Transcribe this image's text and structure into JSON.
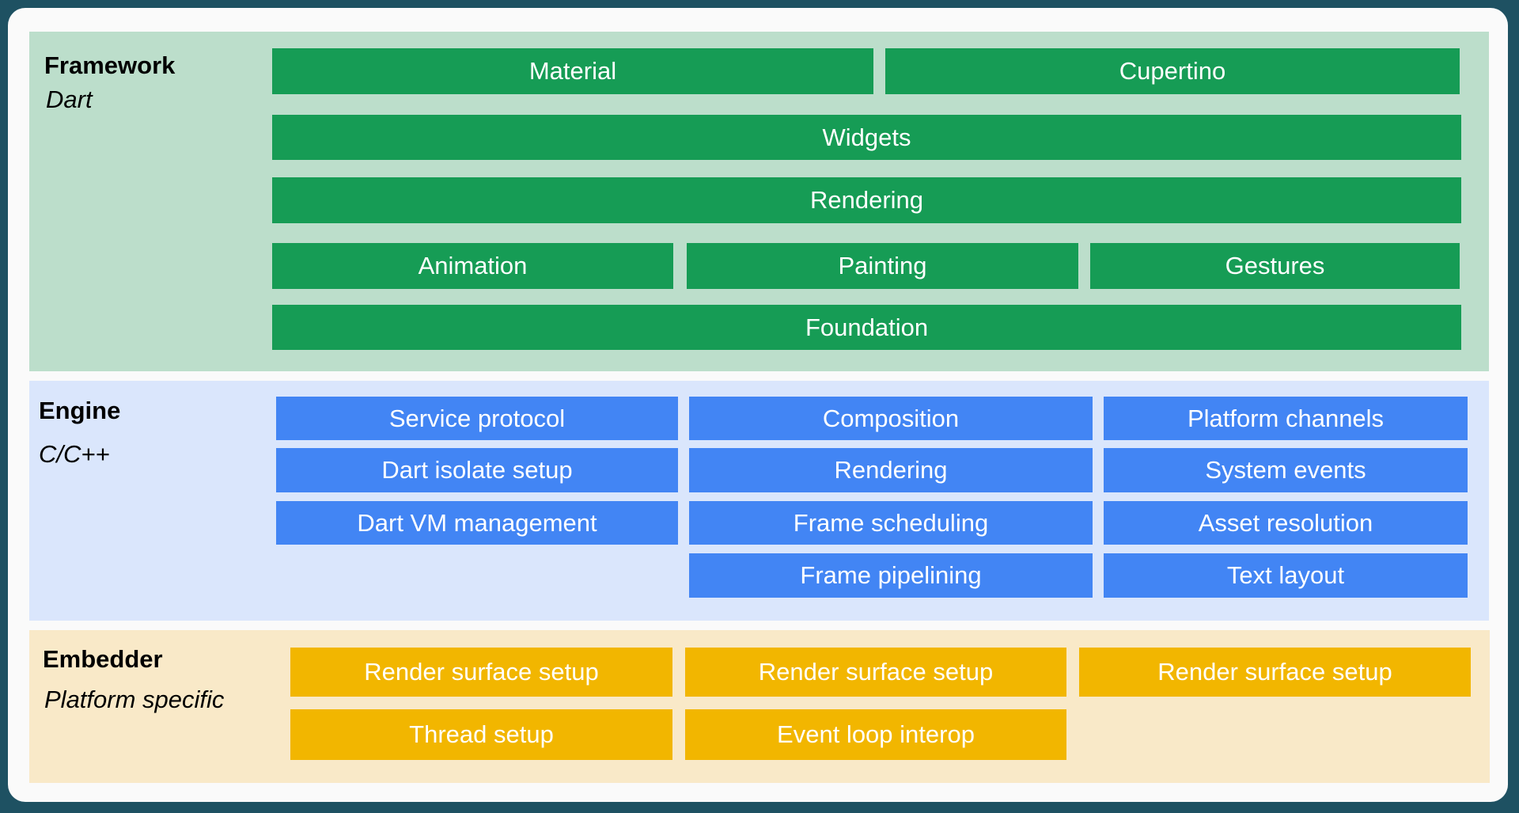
{
  "colors": {
    "border": "#1e5162",
    "framework_bg": "#bcdecb",
    "framework_box": "#169c55",
    "engine_bg": "#dae6fc",
    "engine_box": "#4285f4",
    "embedder_bg": "#f9e9c8",
    "embedder_box": "#f2b600"
  },
  "framework": {
    "title": "Framework",
    "subtitle": "Dart",
    "boxes": [
      "Material",
      "Cupertino",
      "Widgets",
      "Rendering",
      "Animation",
      "Painting",
      "Gestures",
      "Foundation"
    ]
  },
  "engine": {
    "title": "Engine",
    "subtitle": "C/C++",
    "boxes": [
      "Service protocol",
      "Composition",
      "Platform channels",
      "Dart isolate setup",
      "Rendering",
      "System events",
      "Dart VM management",
      "Frame scheduling",
      "Asset resolution",
      "Frame pipelining",
      "Text layout"
    ]
  },
  "embedder": {
    "title": "Embedder",
    "subtitle": "Platform specific",
    "boxes": [
      "Render surface setup",
      "Render surface setup",
      "Render surface setup",
      "Thread setup",
      "Event loop interop"
    ]
  }
}
